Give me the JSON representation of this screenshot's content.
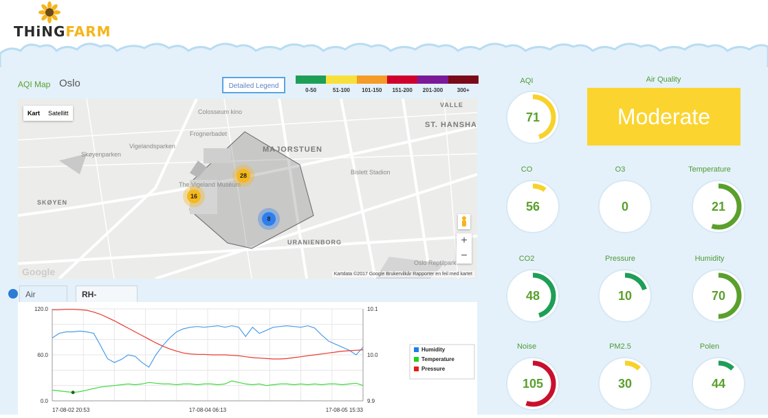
{
  "brand": {
    "name_part1": "THiNG",
    "name_part2": "FARM"
  },
  "map_panel": {
    "title": "AQI Map",
    "city": "Oslo",
    "legend_button": "Detailed Legend",
    "scale": [
      {
        "label": "0-50",
        "color": "#1e9f57"
      },
      {
        "label": "51-100",
        "color": "#f7e03a"
      },
      {
        "label": "101-150",
        "color": "#f59b27"
      },
      {
        "label": "151-200",
        "color": "#d0002c"
      },
      {
        "label": "201-300",
        "color": "#7a1a99"
      },
      {
        "label": "300+",
        "color": "#7a0a1a"
      }
    ],
    "map_type": {
      "map": "Kart",
      "satellite": "Satellitt"
    },
    "zoom": {
      "in": "+",
      "out": "−"
    },
    "attribution": "Kartdata ©2017 Google   Brukervilkår   Rapporter en feil med kartet",
    "google": "Google",
    "places": [
      "Colosseum kino",
      "VALLE",
      "ST. HANSHA",
      "Frognerbadet",
      "Vigelandsparken",
      "MAJORSTUEN",
      "Skøyenparken",
      "Bislett Stadion",
      "The Vigeland Museum",
      "SKØYEN",
      "URANIENBORG",
      "Oslo Reptilpark"
    ],
    "clusters": [
      {
        "count": "28",
        "color": "#f6b81a"
      },
      {
        "count": "16",
        "color": "#f6b81a"
      },
      {
        "count": "8",
        "color": "#2d7ff0"
      }
    ]
  },
  "chart_tabs": {
    "tab1": "Air freshness",
    "tab2": "RH-Temperature"
  },
  "chart_data": {
    "type": "line",
    "x_labels": [
      "17-08-02 20:53",
      "17-08-04 06:13",
      "17-08-05 15:33"
    ],
    "left_axis": {
      "ticks": [
        "120.0",
        "60.0",
        "0.0"
      ],
      "ylim": [
        0,
        120
      ]
    },
    "right_axis": {
      "ticks": [
        "10.1",
        "10.0",
        "9.9"
      ],
      "ylim": [
        9.9,
        10.1
      ]
    },
    "legend": [
      {
        "name": "Humidity",
        "color": "#1e7ee6"
      },
      {
        "name": "Temperature",
        "color": "#22d022"
      },
      {
        "name": "Pressure",
        "color": "#e01e1e"
      }
    ],
    "series": [
      {
        "name": "Humidity",
        "axis": "left",
        "color": "#4a9be8",
        "values": [
          82,
          88,
          90,
          90,
          91,
          90,
          88,
          72,
          55,
          50,
          54,
          60,
          58,
          50,
          44,
          60,
          72,
          82,
          90,
          94,
          96,
          97,
          96,
          97,
          98,
          96,
          98,
          96,
          84,
          96,
          88,
          92,
          96,
          97,
          98,
          97,
          96,
          98,
          95,
          86,
          78,
          74,
          70,
          66,
          60,
          70
        ]
      },
      {
        "name": "Temperature",
        "axis": "left",
        "color": "#3ddb3d",
        "values": [
          14,
          13,
          12,
          11,
          12,
          14,
          16,
          18,
          19,
          20,
          21,
          22,
          21,
          22,
          24,
          23,
          22,
          22,
          21,
          22,
          22,
          21,
          22,
          22,
          21,
          22,
          26,
          24,
          22,
          21,
          22,
          20,
          21,
          22,
          22,
          21,
          22,
          21,
          22,
          21,
          22,
          22,
          21,
          22,
          23,
          20
        ]
      },
      {
        "name": "Pressure",
        "axis": "right",
        "color": "#e8372b",
        "values": [
          10.098,
          10.098,
          10.099,
          10.099,
          10.098,
          10.097,
          10.093,
          10.088,
          10.081,
          10.074,
          10.066,
          10.058,
          10.05,
          10.042,
          10.034,
          10.026,
          10.019,
          10.013,
          10.008,
          10.004,
          10.002,
          10.001,
          10.001,
          10.0,
          10.0,
          10.0,
          9.999,
          9.998,
          9.996,
          9.994,
          9.993,
          9.992,
          9.991,
          9.991,
          9.992,
          9.994,
          9.996,
          9.998,
          10.0,
          10.002,
          10.004,
          10.006,
          10.008,
          10.009,
          10.01,
          10.011
        ]
      }
    ]
  },
  "tiles": [
    {
      "label": "AQI",
      "value": "71",
      "fraction": 0.45,
      "color": "#f7d22a"
    },
    {
      "label": "CO",
      "value": "56",
      "fraction": 0.1,
      "color": "#f7d22a"
    },
    {
      "label": "O3",
      "value": "0",
      "fraction": 0,
      "color": "#1e9f57"
    },
    {
      "label": "Temperature",
      "value": "21",
      "fraction": 0.55,
      "color": "#5aa02c"
    },
    {
      "label": "CO2",
      "value": "48",
      "fraction": 0.45,
      "color": "#1e9f57"
    },
    {
      "label": "Pressure",
      "value": "10",
      "fraction": 0.2,
      "color": "#1e9f57"
    },
    {
      "label": "Humidity",
      "value": "70",
      "fraction": 0.5,
      "color": "#5aa02c"
    },
    {
      "label": "Noise",
      "value": "105",
      "fraction": 0.55,
      "color": "#c8102e"
    },
    {
      "label": "PM2.5",
      "value": "30",
      "fraction": 0.12,
      "color": "#f7d22a"
    },
    {
      "label": "Polen",
      "value": "44",
      "fraction": 0.12,
      "color": "#1e9f57"
    }
  ],
  "air_quality": {
    "label": "Air Quality",
    "value": "Moderate",
    "color": "#fbd42f"
  }
}
